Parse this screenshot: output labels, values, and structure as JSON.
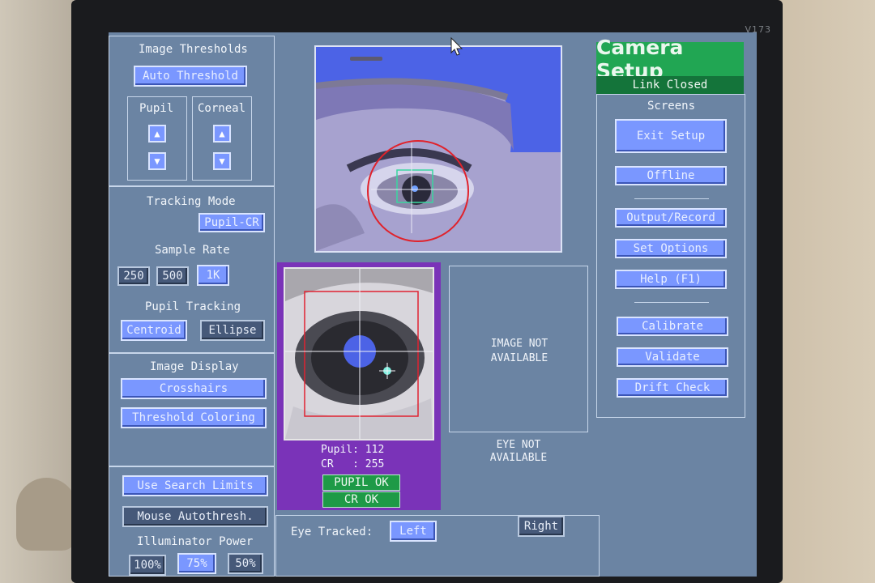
{
  "thresholds": {
    "title": "Image Thresholds",
    "auto_label": "Auto Threshold",
    "pupil_label": "Pupil",
    "corneal_label": "Corneal"
  },
  "tracking_mode": {
    "title": "Tracking Mode",
    "value": "Pupil-CR"
  },
  "sample_rate": {
    "title": "Sample Rate",
    "options": [
      "250",
      "500",
      "1K"
    ]
  },
  "pupil_tracking": {
    "title": "Pupil Tracking",
    "options": [
      "Centroid",
      "Ellipse"
    ]
  },
  "image_display": {
    "title": "Image Display",
    "crosshairs": "Crosshairs",
    "threshold_coloring": "Threshold Coloring"
  },
  "search": {
    "use_search_limits": "Use Search Limits",
    "mouse_autothresh": "Mouse Autothresh."
  },
  "illuminator": {
    "title": "Illuminator Power",
    "options": [
      "100%",
      "75%",
      "50%"
    ]
  },
  "header": {
    "title": "Camera Setup",
    "status": "Link Closed"
  },
  "screens": {
    "title": "Screens",
    "exit_setup": "Exit Setup",
    "offline": "Offline",
    "output_record": "Output/Record",
    "set_options": "Set Options",
    "help": "Help (F1)",
    "calibrate": "Calibrate",
    "validate": "Validate",
    "drift_check": "Drift Check"
  },
  "eye_readout": {
    "pupil_line": "Pupil: 112",
    "cr_line": "CR   : 255",
    "pupil_ok": "PUPIL OK",
    "cr_ok": "CR  OK"
  },
  "unavailable": {
    "image_l1": "IMAGE NOT",
    "image_l2": "AVAILABLE",
    "eye_l1": "EYE NOT",
    "eye_l2": "AVAILABLE"
  },
  "eye_tracked": {
    "label": "Eye Tracked:",
    "left": "Left",
    "right": "Right"
  },
  "bezel": {
    "model": "V173"
  },
  "colors": {
    "screen_bg": "#6b84a3",
    "button": "#7a97ff",
    "title_green": "#21a653",
    "camera_blue": "#4c63e6",
    "eye_panel_purple": "#7a33b8",
    "track_circle": "#e0222b"
  }
}
